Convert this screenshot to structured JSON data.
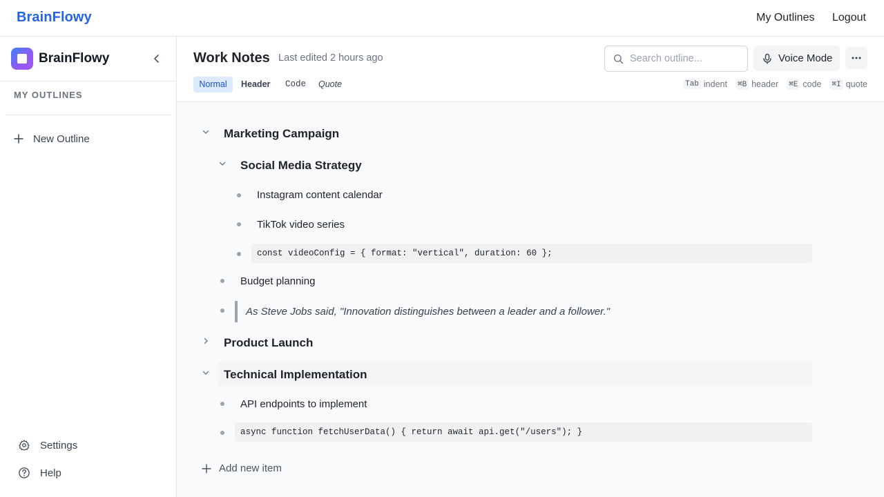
{
  "app": {
    "brand": "BrainFlowy"
  },
  "topnav": {
    "my_outlines": "My Outlines",
    "logout": "Logout"
  },
  "sidebar": {
    "brand": "BrainFlowy",
    "section_label": "MY OUTLINES",
    "new_outline": "New Outline",
    "settings": "Settings",
    "help": "Help"
  },
  "document": {
    "title": "Work Notes",
    "last_edited": "Last edited 2 hours ago"
  },
  "search": {
    "placeholder": "Search outline..."
  },
  "toolbar": {
    "voice_mode": "Voice Mode",
    "formats": {
      "normal": "Normal",
      "header": "Header",
      "code": "Code",
      "quote": "Quote"
    },
    "shortcuts": [
      {
        "key": "Tab",
        "action": "indent"
      },
      {
        "key": "⌘B",
        "action": "header"
      },
      {
        "key": "⌘E",
        "action": "code"
      },
      {
        "key": "⌘I",
        "action": "quote"
      }
    ]
  },
  "outline": {
    "marketing": {
      "title": "Marketing Campaign",
      "social": {
        "title": "Social Media Strategy",
        "items": [
          "Instagram content calendar",
          "TikTok video series"
        ],
        "code": "const videoConfig = { format: \"vertical\", duration: 60 };"
      },
      "budget": "Budget planning",
      "quote": "As Steve Jobs said, \"Innovation distinguishes between a leader and a follower.\""
    },
    "product_launch": {
      "title": "Product Launch"
    },
    "technical": {
      "title": "Technical Implementation",
      "item": "API endpoints to implement",
      "code": "async function fetchUserData() { return await api.get(\"/users\"); }"
    },
    "add_item": "Add new item"
  },
  "colors": {
    "accent": "#2563eb",
    "selected_format_bg": "#dbeafe"
  }
}
